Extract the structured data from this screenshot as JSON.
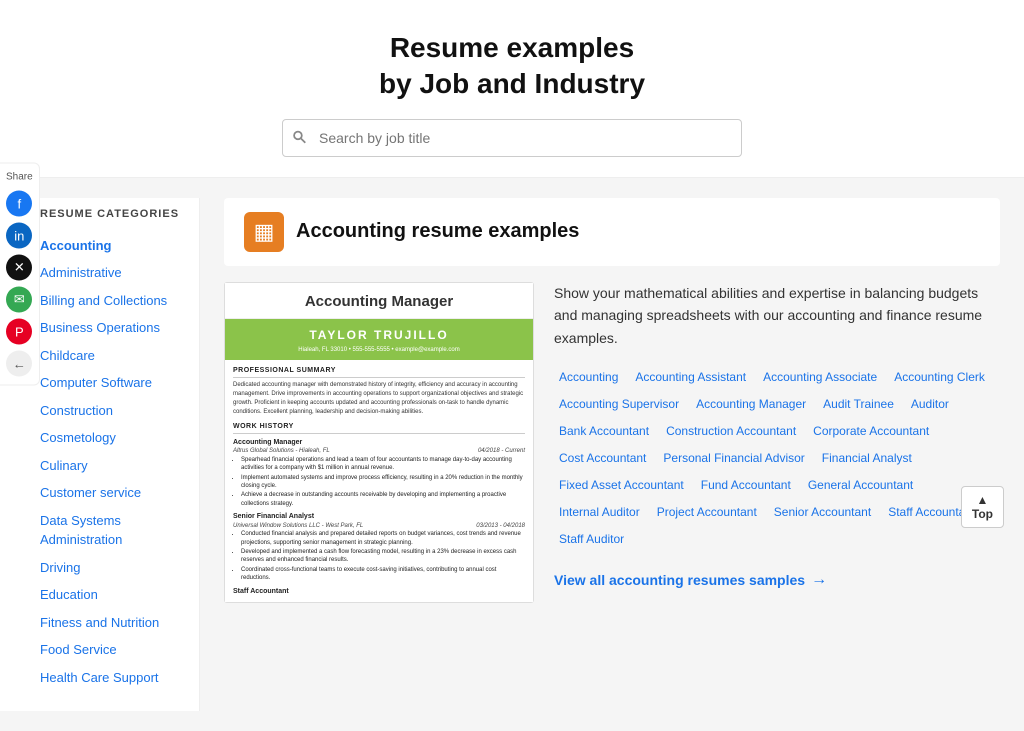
{
  "header": {
    "title_line1": "Resume examples",
    "title_line2": "by Job and Industry",
    "search_placeholder": "Search by job title"
  },
  "share": {
    "label": "Share",
    "icons": [
      {
        "name": "facebook-icon",
        "class": "fb",
        "symbol": "f"
      },
      {
        "name": "linkedin-icon",
        "class": "li",
        "symbol": "in"
      },
      {
        "name": "twitter-icon",
        "class": "tw",
        "symbol": "𝕏"
      },
      {
        "name": "email-icon",
        "class": "em",
        "symbol": "✉"
      },
      {
        "name": "pinterest-icon",
        "class": "pi",
        "symbol": "P"
      },
      {
        "name": "back-icon",
        "class": "back",
        "symbol": "←"
      }
    ]
  },
  "sidebar": {
    "title": "RESUME CATEGORIES",
    "categories": [
      {
        "label": "Accounting",
        "active": true
      },
      {
        "label": "Administrative",
        "active": false
      },
      {
        "label": "Billing and Collections",
        "active": false
      },
      {
        "label": "Business Operations",
        "active": false
      },
      {
        "label": "Childcare",
        "active": false
      },
      {
        "label": "Computer Software",
        "active": false
      },
      {
        "label": "Construction",
        "active": false
      },
      {
        "label": "Cosmetology",
        "active": false
      },
      {
        "label": "Culinary",
        "active": false
      },
      {
        "label": "Customer service",
        "active": false
      },
      {
        "label": "Data Systems Administration",
        "active": false
      },
      {
        "label": "Driving",
        "active": false
      },
      {
        "label": "Education",
        "active": false
      },
      {
        "label": "Fitness and Nutrition",
        "active": false
      },
      {
        "label": "Food Service",
        "active": false
      },
      {
        "label": "Health Care Support",
        "active": false
      }
    ]
  },
  "page": {
    "icon_symbol": "▦",
    "title": "Accounting resume examples",
    "resume_card_title": "Accounting Manager",
    "resume_preview": {
      "name": "TAYLOR TRUJILLO",
      "contact": "Hialeah, FL 33010 • 555-555-5555 • example@example.com",
      "summary_title": "PROFESSIONAL SUMMARY",
      "summary": "Dedicated accounting manager with demonstrated history of integrity, efficiency and accuracy in accounting management. Drive improvements in accounting operations to support organizational objectives and strategic growth. Proficient in keeping accounts updated and accounting professionals on-task to handle dynamic conditions. Excellent planning, leadership and decision-making abilities.",
      "work_title": "WORK HISTORY",
      "jobs": [
        {
          "title": "Accounting Manager",
          "company": "Altrus Global Solutions - Hialeah, FL",
          "dates": "04/2018 - Current",
          "bullets": [
            "Spearhead financial operations and lead a team of four accountants to manage day-to-day accounting activities for a company with $1 million in annual revenue.",
            "Implement automated systems and improve process efficiency, resulting in a 20% reduction in the monthly closing cycle.",
            "Achieve a decrease in outstanding accounts receivable by developing and implementing a proactive collections strategy."
          ]
        },
        {
          "title": "Senior Financial Analyst",
          "company": "Universal Window Solutions LLC - West Park, FL",
          "dates": "03/2013 - 04/2018",
          "bullets": [
            "Conducted financial analysis and prepared detailed reports on budget variances, cost trends and revenue projections, supporting senior management in strategic planning.",
            "Developed and implemented a cash flow forecasting model, resulting in a 23% decrease in excess cash reserves and enhanced financial results.",
            "Coordinated cross-functional teams to execute cost-saving initiatives, contributing to annual cost reductions."
          ]
        }
      ],
      "next_job_title": "Staff Accountant"
    },
    "description": "Show your mathematical abilities and expertise in balancing budgets and managing spreadsheets with our accounting and finance resume examples.",
    "tags": [
      "Accounting",
      "Accounting Assistant",
      "Accounting Associate",
      "Accounting Clerk",
      "Accounting Supervisor",
      "Accounting Manager",
      "Audit Trainee",
      "Auditor",
      "Bank Accountant",
      "Construction Accountant",
      "Corporate Accountant",
      "Cost Accountant",
      "Personal Financial Advisor",
      "Financial Analyst",
      "Fixed Asset Accountant",
      "Fund Accountant",
      "General Accountant",
      "Internal Auditor",
      "Project Accountant",
      "Senior Accountant",
      "Staff Accountant",
      "Staff Auditor"
    ],
    "view_all_label": "View all accounting resumes samples",
    "top_label": "Top"
  }
}
